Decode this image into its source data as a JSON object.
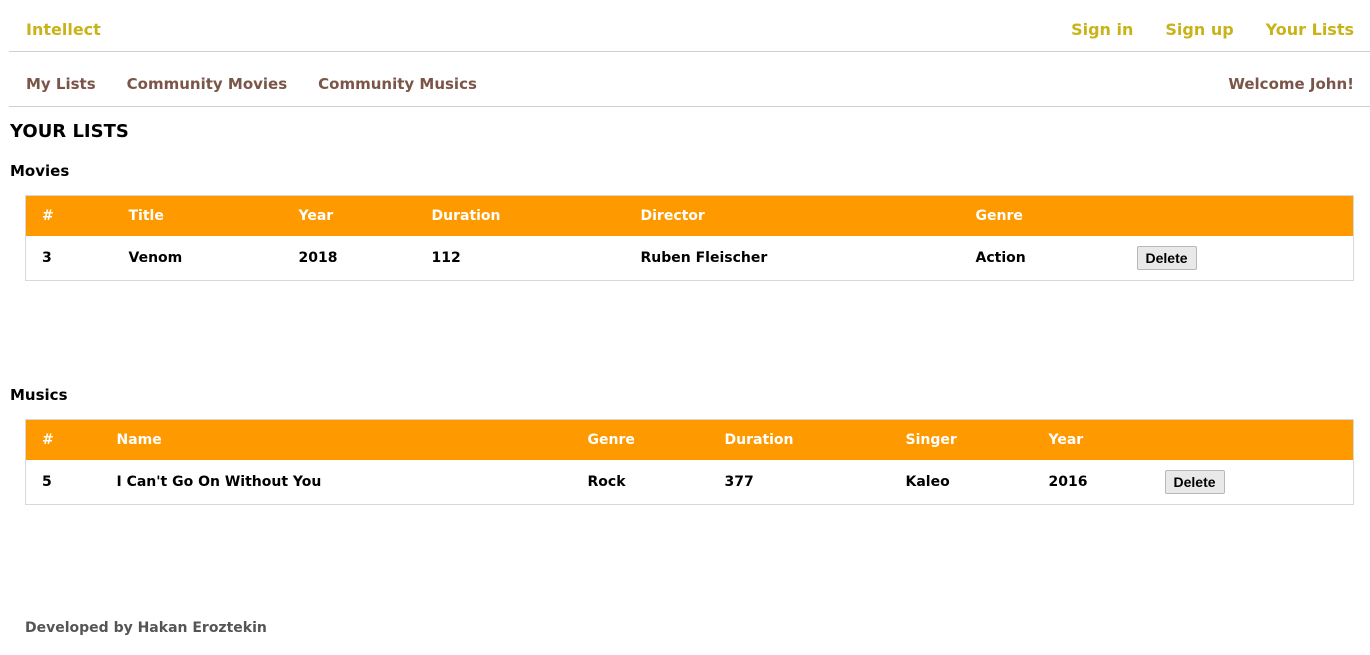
{
  "header": {
    "brand": "Intellect",
    "links": {
      "sign_in": "Sign in",
      "sign_up": "Sign up",
      "your_lists": "Your Lists"
    }
  },
  "nav": {
    "my_lists": "My Lists",
    "community_movies": "Community Movies",
    "community_musics": "Community Musics",
    "welcome": "Welcome John!"
  },
  "page": {
    "title": "YOUR LISTS"
  },
  "movies": {
    "title": "Movies",
    "headers": {
      "id": "#",
      "title": "Title",
      "year": "Year",
      "duration": "Duration",
      "director": "Director",
      "genre": "Genre"
    },
    "rows": [
      {
        "id": "3",
        "title": "Venom",
        "year": "2018",
        "duration": "112",
        "director": "Ruben Fleischer",
        "genre": "Action",
        "action": "Delete"
      }
    ]
  },
  "musics": {
    "title": "Musics",
    "headers": {
      "id": "#",
      "name": "Name",
      "genre": "Genre",
      "duration": "Duration",
      "singer": "Singer",
      "year": "Year"
    },
    "rows": [
      {
        "id": "5",
        "name": "I Can't Go On Without You",
        "genre": "Rock",
        "duration": "377",
        "singer": "Kaleo",
        "year": "2016",
        "action": "Delete"
      }
    ]
  },
  "footer": {
    "text": "Developed by Hakan Eroztekin"
  },
  "colors": {
    "brand": "#c9b31a",
    "nav": "#7a5548",
    "table_header": "#ff9900"
  }
}
